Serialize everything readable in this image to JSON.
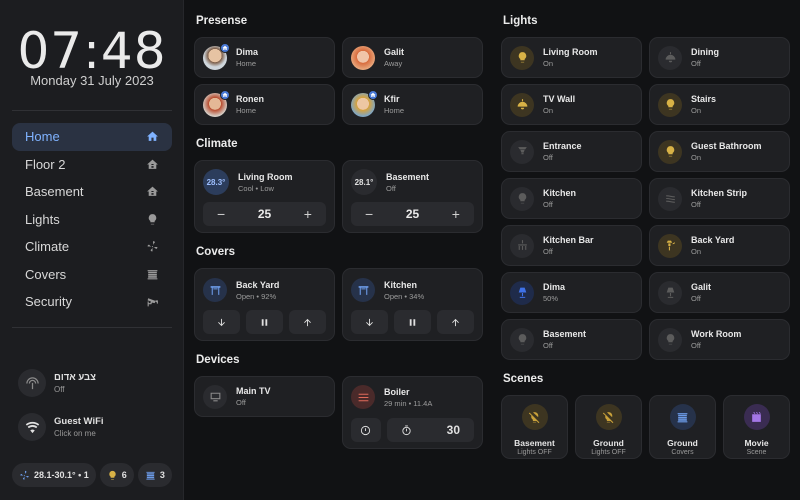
{
  "clock": {
    "time": "07:48",
    "date": "Monday 31 July 2023"
  },
  "nav": [
    {
      "label": "Home",
      "icon": "home-icon"
    },
    {
      "label": "Floor 2",
      "icon": "floor-icon"
    },
    {
      "label": "Basement",
      "icon": "floor-icon"
    },
    {
      "label": "Lights",
      "icon": "bulb-icon"
    },
    {
      "label": "Climate",
      "icon": "fan-icon"
    },
    {
      "label": "Covers",
      "icon": "blinds-icon"
    },
    {
      "label": "Security",
      "icon": "cctv-icon"
    }
  ],
  "sidebar_entities": [
    {
      "name": "צבע אדום",
      "state": "Off",
      "icon": "alarm-icon"
    },
    {
      "name": "Guest WiFi",
      "state": "Click on me",
      "icon": "wifi-icon"
    }
  ],
  "chips": [
    {
      "label": "28.1-30.1° • 1",
      "icon": "fan-icon"
    },
    {
      "label": "6",
      "icon": "bulb-icon"
    },
    {
      "label": "3",
      "icon": "blinds-icon"
    }
  ],
  "sections": {
    "presence": "Presense",
    "climate": "Climate",
    "covers": "Covers",
    "devices": "Devices",
    "lights": "Lights",
    "scenes": "Scenes"
  },
  "presence": [
    {
      "name": "Dima",
      "state": "Home",
      "home": true
    },
    {
      "name": "Galit",
      "state": "Away",
      "home": false
    },
    {
      "name": "Ronen",
      "state": "Home",
      "home": true
    },
    {
      "name": "Kfir",
      "state": "Home",
      "home": true
    }
  ],
  "climate": [
    {
      "name": "Living Room",
      "state": "Cool • Low",
      "temp": "28.3°",
      "target": "25",
      "minus": "−",
      "plus": "+"
    },
    {
      "name": "Basement",
      "state": "Off",
      "temp": "28.1°",
      "target": "25",
      "minus": "−",
      "plus": "+"
    }
  ],
  "covers": [
    {
      "name": "Back Yard",
      "state": "Open • 92%"
    },
    {
      "name": "Kitchen",
      "state": "Open • 34%"
    }
  ],
  "devices": [
    {
      "name": "Main TV",
      "state": "Off"
    },
    {
      "name": "Boiler",
      "state": "29 min • 11.4A",
      "timer": "30"
    }
  ],
  "lights": [
    {
      "name": "Living Room",
      "state": "On",
      "on": true,
      "icon": "bulb-icon"
    },
    {
      "name": "Dining",
      "state": "Off",
      "on": false,
      "icon": "ceiling-light-icon"
    },
    {
      "name": "TV Wall",
      "state": "On",
      "on": true,
      "icon": "ceiling-light-icon"
    },
    {
      "name": "Stairs",
      "state": "On",
      "on": true,
      "icon": "bulb-icon"
    },
    {
      "name": "Entrance",
      "state": "Off",
      "on": false,
      "icon": "spot-light-icon"
    },
    {
      "name": "Guest Bathroom",
      "state": "On",
      "on": true,
      "icon": "bulb-icon"
    },
    {
      "name": "Kitchen",
      "state": "Off",
      "on": false,
      "icon": "bulb-icon"
    },
    {
      "name": "Kitchen Strip",
      "state": "Off",
      "on": false,
      "icon": "led-strip-icon"
    },
    {
      "name": "Kitchen Bar",
      "state": "Off",
      "on": false,
      "icon": "chandelier-icon"
    },
    {
      "name": "Back Yard",
      "state": "On",
      "on": true,
      "icon": "outdoor-light-icon"
    },
    {
      "name": "Dima",
      "state": "50%",
      "on": true,
      "blue": true,
      "icon": "lamp-icon"
    },
    {
      "name": "Galit",
      "state": "Off",
      "on": false,
      "icon": "lamp-icon"
    },
    {
      "name": "Basement",
      "state": "Off",
      "on": false,
      "icon": "bulb-icon"
    },
    {
      "name": "Work Room",
      "state": "Off",
      "on": false,
      "icon": "bulb-icon"
    }
  ],
  "scenes": [
    {
      "name": "Basement",
      "state": "Lights OFF",
      "color": "#c9a13a",
      "bg": "#3d3521",
      "icon": "lightbulb-off-icon"
    },
    {
      "name": "Ground",
      "state": "Lights OFF",
      "color": "#c9a13a",
      "bg": "#3d3521",
      "icon": "lightbulb-off-icon"
    },
    {
      "name": "Ground",
      "state": "Covers",
      "color": "#6c9be8",
      "bg": "#26324a",
      "icon": "blinds-icon"
    },
    {
      "name": "Movie",
      "state": "Scene",
      "color": "#a477e8",
      "bg": "#3a2c52",
      "icon": "movie-icon"
    }
  ],
  "colors": {
    "accent": "#7fb2ff",
    "on_yellow": "#d8b246",
    "on_bg": "#3d3521"
  }
}
